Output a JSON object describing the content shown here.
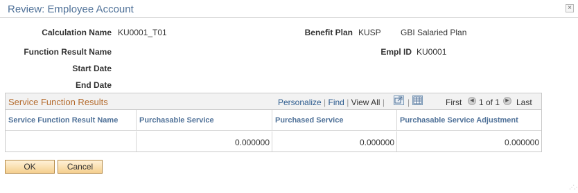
{
  "dialog": {
    "title": "Review: Employee Account",
    "close_glyph": "×"
  },
  "fields": {
    "calculation_name_label": "Calculation Name",
    "calculation_name_value": "KU0001_T01",
    "function_result_name_label": "Function Result Name",
    "start_date_label": "Start Date",
    "end_date_label": "End Date",
    "benefit_plan_label": "Benefit Plan",
    "benefit_plan_code": "KUSP",
    "benefit_plan_desc": "GBI Salaried Plan",
    "empl_id_label": "Empl ID",
    "empl_id_value": "KU0001"
  },
  "grid": {
    "title": "Service Function Results",
    "toolbar": {
      "personalize": "Personalize",
      "find": "Find",
      "view_all": "View All",
      "first": "First",
      "range": "1 of 1",
      "last": "Last",
      "sep": "|"
    },
    "columns": [
      "Service Function Result Name",
      "Purchasable Service",
      "Purchased Service",
      "Purchasable Service Adjustment"
    ],
    "rows": [
      [
        "",
        "0.000000",
        "0.000000",
        "0.000000"
      ]
    ]
  },
  "buttons": {
    "ok": "OK",
    "cancel": "Cancel"
  },
  "icons": {
    "zoom": "zoom-icon",
    "download": "download-to-excel-icon",
    "prev": "previous-arrow-icon",
    "next": "next-arrow-icon"
  },
  "colors": {
    "title_blue": "#4f7198",
    "grid_title_orange": "#b46b2d",
    "link_blue": "#2c5b8e",
    "button_fill": "#f5cf8f"
  }
}
